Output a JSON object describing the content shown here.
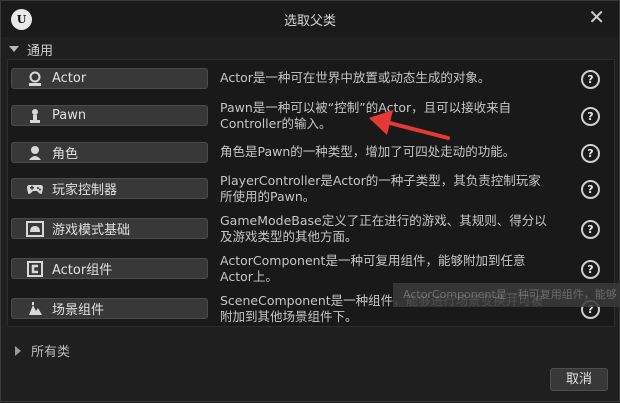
{
  "window": {
    "title": "选取父类",
    "logo_text": "U"
  },
  "section": {
    "label": "通用"
  },
  "classes": [
    {
      "label": "Actor",
      "icon": "actor-icon",
      "description": "Actor是一种可在世界中放置或动态生成的对象。"
    },
    {
      "label": "Pawn",
      "icon": "pawn-icon",
      "description": "Pawn是一种可以被“控制”的Actor，且可以接收来自Controller的输入。"
    },
    {
      "label": "角色",
      "icon": "character-icon",
      "description": "角色是Pawn的一种类型，增加了可四处走动的功能。"
    },
    {
      "label": "玩家控制器",
      "icon": "gamepad-icon",
      "description": "PlayerController是Actor的一种子类型，其负责控制玩家所使用的Pawn。"
    },
    {
      "label": "游戏模式基础",
      "icon": "game-mode-icon",
      "description": "GameModeBase定义了正在进行的游戏、其规则、得分以及游戏类型的其他方面。"
    },
    {
      "label": "Actor组件",
      "icon": "actor-component-icon",
      "description": "ActorComponent是一种可复用组件，能够附加到任意Actor上。"
    },
    {
      "label": "场景组件",
      "icon": "scene-component-icon",
      "description": "SceneComponent是一种组件，能够进行场景变换并可被附加到其他场景组件下。"
    }
  ],
  "help_label": "?",
  "tooltip_ghost": "ActorComponent是一种可复用组件，能够",
  "all_classes": {
    "label": "所有类"
  },
  "cancel_label": "取消",
  "colors": {
    "annotation_arrow": "#e53935",
    "button_bg": "#383838"
  }
}
